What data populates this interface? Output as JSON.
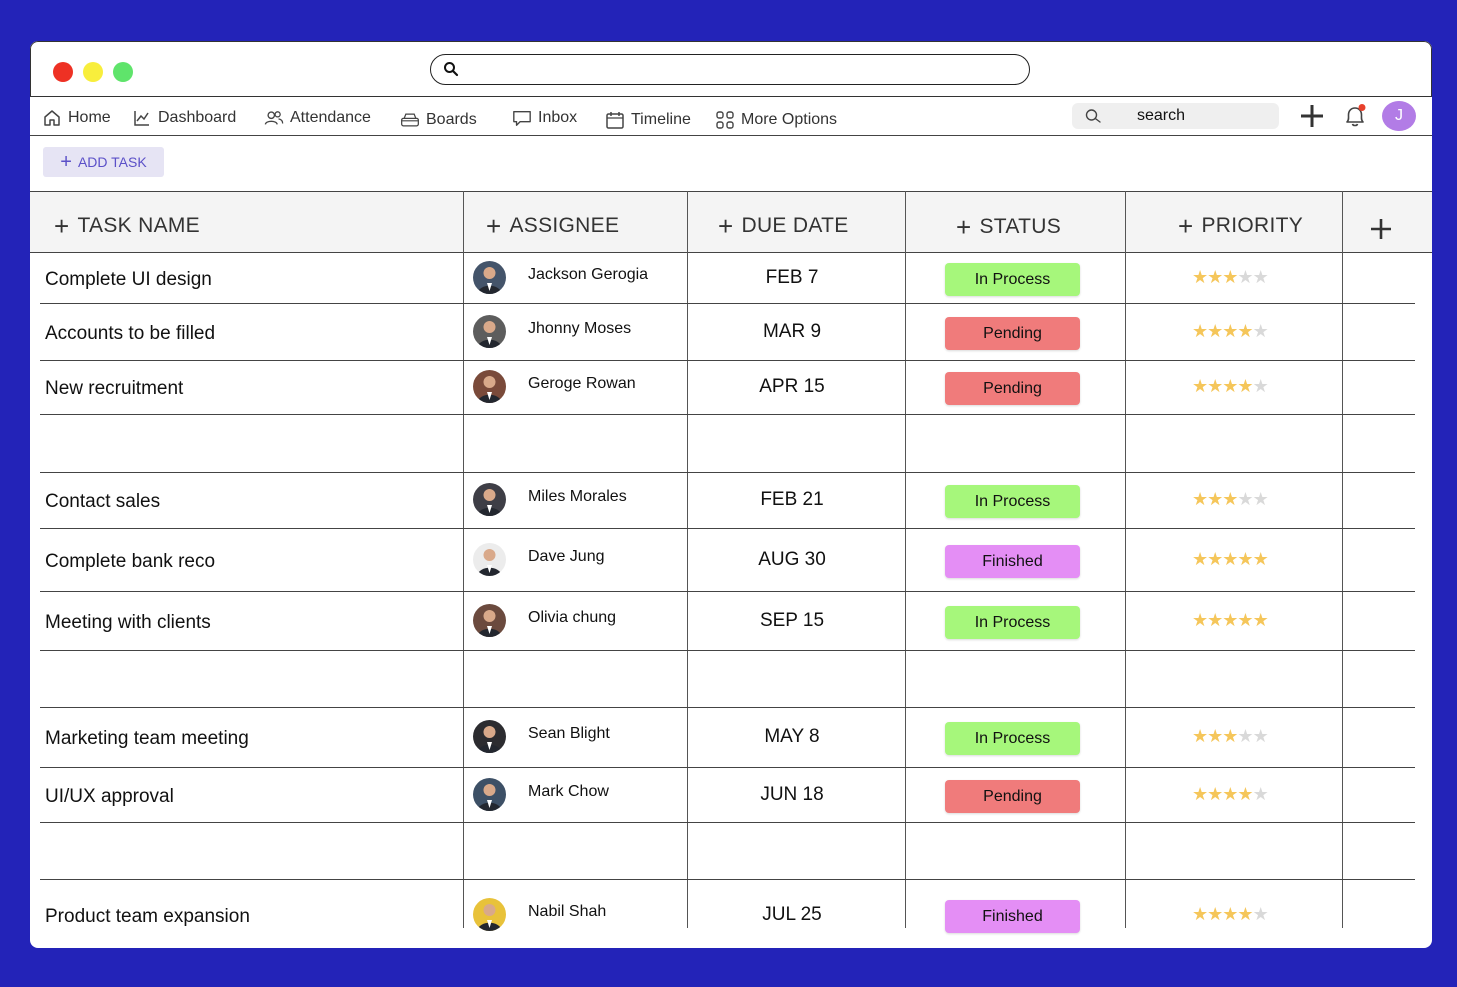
{
  "nav": {
    "items": [
      {
        "label": "Home",
        "icon": "home-icon"
      },
      {
        "label": "Dashboard",
        "icon": "chart-icon"
      },
      {
        "label": "Attendance",
        "icon": "users-icon"
      },
      {
        "label": "Boards",
        "icon": "boards-icon"
      },
      {
        "label": "Inbox",
        "icon": "inbox-icon"
      },
      {
        "label": "Timeline",
        "icon": "calendar-icon"
      },
      {
        "label": "More Options",
        "icon": "grid-icon"
      }
    ],
    "search_label": "search",
    "avatar_initial": "J"
  },
  "toolbar": {
    "add_task_label": "ADD TASK"
  },
  "columns": [
    "TASK NAME",
    "ASSIGNEE",
    "DUE DATE",
    "STATUS",
    "PRIORITY"
  ],
  "status_colors": {
    "In Process": "#a6f77b",
    "Pending": "#f07b7b",
    "Finished": "#e48ef5"
  },
  "rows": [
    {
      "task": "Complete UI design",
      "assignee": "Jackson Gerogia",
      "due": "FEB 7",
      "status": "In Process",
      "priority": 3
    },
    {
      "task": "Accounts to be filled",
      "assignee": "Jhonny Moses",
      "due": "MAR 9",
      "status": "Pending",
      "priority": 4
    },
    {
      "task": "New recruitment",
      "assignee": "Geroge Rowan",
      "due": "APR 15",
      "status": "Pending",
      "priority": 4
    },
    {
      "task": "Contact sales",
      "assignee": "Miles Morales",
      "due": "FEB 21",
      "status": "In Process",
      "priority": 3
    },
    {
      "task": "Complete bank reco",
      "assignee": "Dave Jung",
      "due": "AUG 30",
      "status": "Finished",
      "priority": 5
    },
    {
      "task": "Meeting with clients",
      "assignee": "Olivia chung",
      "due": "SEP 15",
      "status": "In Process",
      "priority": 5
    },
    {
      "task": "Marketing team meeting",
      "assignee": "Sean Blight",
      "due": "MAY 8",
      "status": "In Process",
      "priority": 3
    },
    {
      "task": "UI/UX approval",
      "assignee": "Mark Chow",
      "due": "JUN 18",
      "status": "Pending",
      "priority": 4
    },
    {
      "task": "Product team expansion",
      "assignee": "Nabil Shah",
      "due": "JUL 25",
      "status": "Finished",
      "priority": 4
    }
  ]
}
